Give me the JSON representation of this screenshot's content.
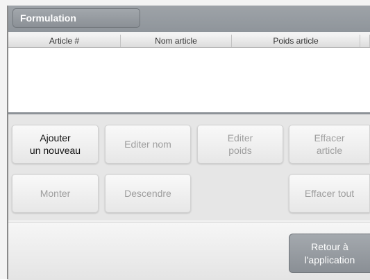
{
  "title_bar": {
    "title": "Formulation"
  },
  "table": {
    "columns": [
      "Article #",
      "Nom article",
      "Poids article"
    ],
    "rows": []
  },
  "buttons": {
    "add_new": "Ajouter\nun nouveau",
    "edit_name": "Editer nom",
    "edit_weight": "Editer\npoids",
    "delete_item": "Effacer\narticle",
    "move_up": "Monter",
    "move_down": "Descendre",
    "delete_all": "Effacer tout"
  },
  "footer": {
    "return_label": "Retour à\nl'application"
  }
}
